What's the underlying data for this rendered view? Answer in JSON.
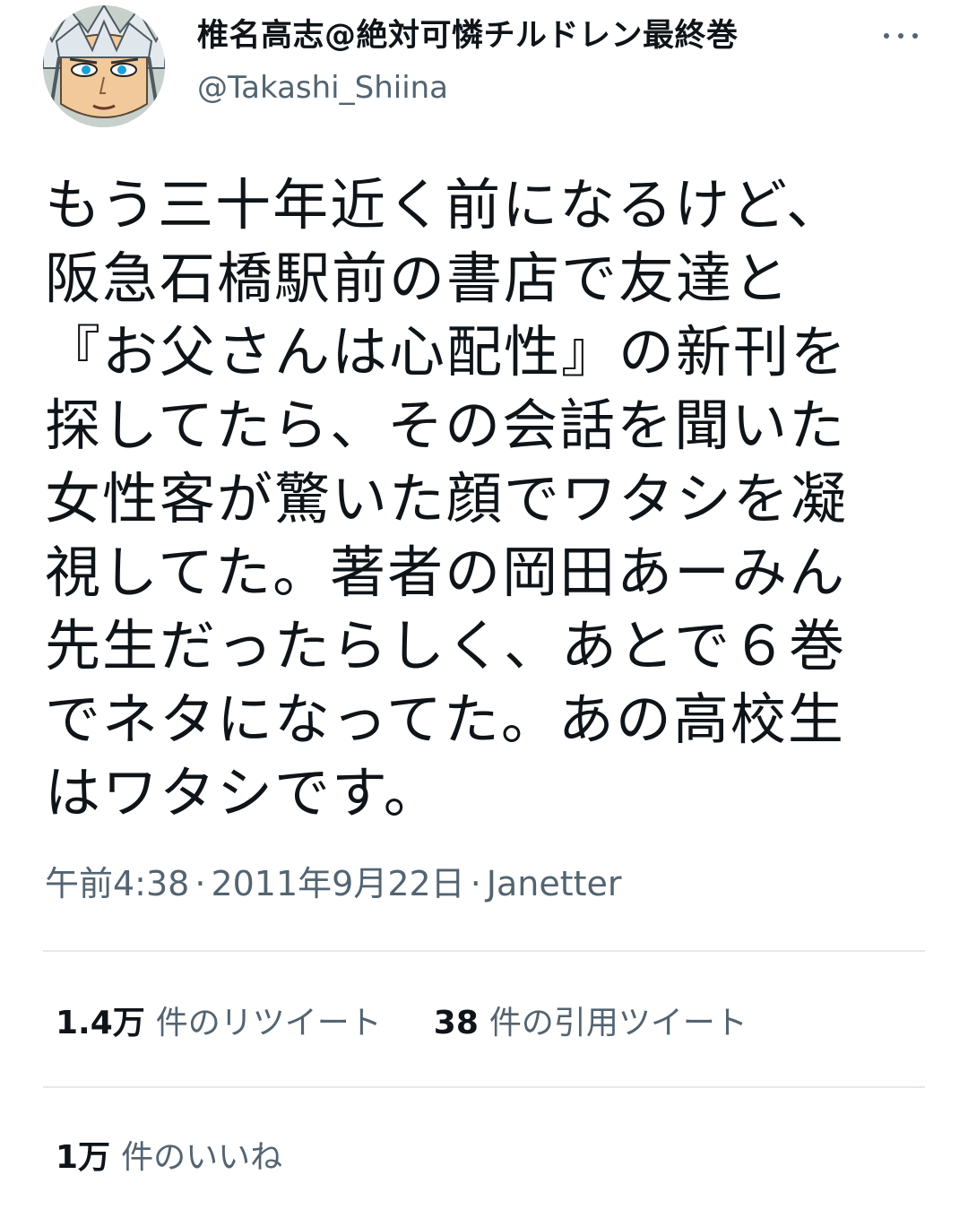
{
  "author": {
    "display_name": "椎名高志@絶対可憐チルドレン最終巻",
    "handle": "@Takashi_Shiina",
    "avatar": "avatar-anime-character-icon"
  },
  "tweet": {
    "text": "もう三十年近く前になるけど、\n阪急石橋駅前の書店で友達と\n『お父さんは心配性』の新刊を\n探してたら、その会話を聞いた\n女性客が驚いた顔でワタシを凝\n視してた。著者の岡田あーみん\n先生だったらしく、あとで６巻\nでネタになってた。あの高校生\nはワタシです。"
  },
  "meta": {
    "time": "午前4:38",
    "date": "2011年9月22日",
    "source": "Janetter",
    "separator": "·"
  },
  "stats": {
    "retweets": {
      "count": "1.4万",
      "label": "件のリツイート"
    },
    "quotes": {
      "count": "38",
      "label": "件の引用ツイート"
    },
    "likes": {
      "count": "1万",
      "label": "件のいいね"
    }
  },
  "icons": {
    "more": "more-horizontal-icon"
  },
  "colors": {
    "text_primary": "#0f1419",
    "text_secondary": "#536471",
    "divider": "#e6e9ea",
    "background": "#ffffff"
  }
}
